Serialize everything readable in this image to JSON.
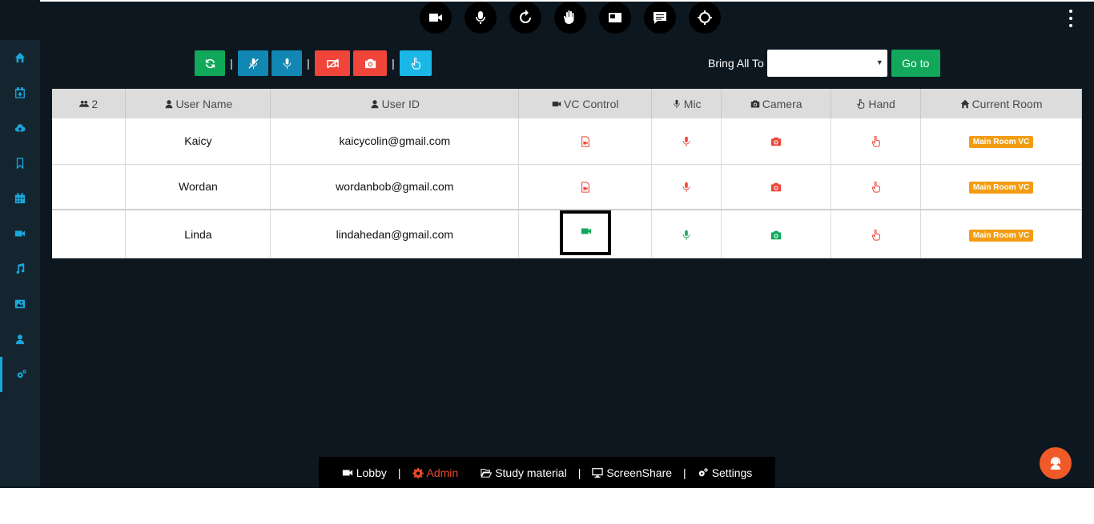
{
  "topbar": {
    "icons": [
      "video-camera-icon",
      "microphone-icon",
      "refresh-icon",
      "raise-hand-icon",
      "layout-icon",
      "chat-icon",
      "crosshair-icon"
    ]
  },
  "sidebar": {
    "items": [
      "home-icon",
      "calendar-plus-icon",
      "cloud-upload-icon",
      "bookmark-icon",
      "calendar-icon",
      "video-icon",
      "music-icon",
      "image-icon",
      "user-icon",
      "gears-icon"
    ],
    "active_index": 9
  },
  "actionbar": {
    "buttons": [
      "refresh",
      "mute-all-mic",
      "unmute-all-mic",
      "disable-all-video",
      "disable-all-camera",
      "lower-all-hands"
    ]
  },
  "bring": {
    "label": "Bring All To",
    "selected": "",
    "go_label": "Go to"
  },
  "table": {
    "headers": {
      "count": "2",
      "user_name": "User Name",
      "user_id": "User ID",
      "vc_control": "VC Control",
      "mic": "Mic",
      "camera": "Camera",
      "hand": "Hand",
      "current_room": "Current Room"
    },
    "rows": [
      {
        "name": "Kaicy",
        "user_id": "kaicycolin@gmail.com",
        "vc": "off",
        "mic": "off",
        "camera": "off",
        "hand": "off",
        "room": "Main Room VC"
      },
      {
        "name": "Wordan",
        "user_id": "wordanbob@gmail.com",
        "vc": "off",
        "mic": "off",
        "camera": "off",
        "hand": "off",
        "room": "Main Room VC"
      },
      {
        "name": "Linda",
        "user_id": "lindahedan@gmail.com",
        "vc": "on",
        "mic": "on",
        "camera": "on",
        "hand": "off",
        "room": "Main Room VC"
      }
    ]
  },
  "bottombar": {
    "lobby": "Lobby",
    "admin": "Admin",
    "study": "Study material",
    "screenshare": "ScreenShare",
    "settings": "Settings"
  },
  "colors": {
    "background": "#0d1720",
    "accent": "#1aa6d9",
    "on": "#11a85b",
    "off": "#f0453a",
    "badge": "#f39c12"
  }
}
